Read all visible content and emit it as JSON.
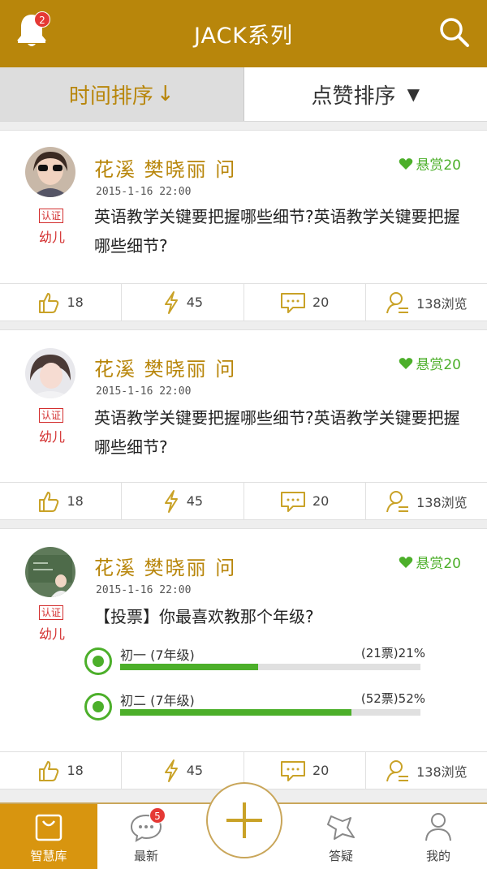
{
  "header": {
    "title": "JACK系列",
    "notification_count": "2"
  },
  "sort": {
    "time_label": "时间排序",
    "time_arrow": "↓",
    "likes_label": "点赞排序",
    "likes_arrow": "▼"
  },
  "posts": [
    {
      "author": "花溪 樊晓丽 问",
      "reward": "悬赏20",
      "time": "2015-1-16 22:00",
      "cert": "认证",
      "grade": "幼儿",
      "question": "英语教学关键要把握哪些细节?英语教学关键要把握哪些细节?",
      "likes": "18",
      "shares": "45",
      "comments": "20",
      "views": "138浏览"
    },
    {
      "author": "花溪 樊晓丽 问",
      "reward": "悬赏20",
      "time": "2015-1-16 22:00",
      "cert": "认证",
      "grade": "幼儿",
      "question": "英语教学关键要把握哪些细节?英语教学关键要把握哪些细节?",
      "likes": "18",
      "shares": "45",
      "comments": "20",
      "views": "138浏览"
    },
    {
      "author": "花溪 樊晓丽 问",
      "reward": "悬赏20",
      "time": "2015-1-16 22:00",
      "cert": "认证",
      "grade": "幼儿",
      "question": "【投票】你最喜欢教那个年级?",
      "vote_options": [
        {
          "label": "初一 (7年级)",
          "count": "(21票)21%",
          "percent": 46
        },
        {
          "label": "初二 (7年级)",
          "count": "(52票)52%",
          "percent": 77
        }
      ],
      "likes": "18",
      "shares": "45",
      "comments": "20",
      "views": "138浏览"
    }
  ],
  "tabbar": {
    "tab1": "智慧库",
    "tab2": "最新",
    "tab2_badge": "5",
    "tab4": "答疑",
    "tab5": "我的"
  },
  "colors": {
    "brand": "#b8860b",
    "accent_green": "#4caf2a",
    "cert_red": "#d32f2f"
  }
}
